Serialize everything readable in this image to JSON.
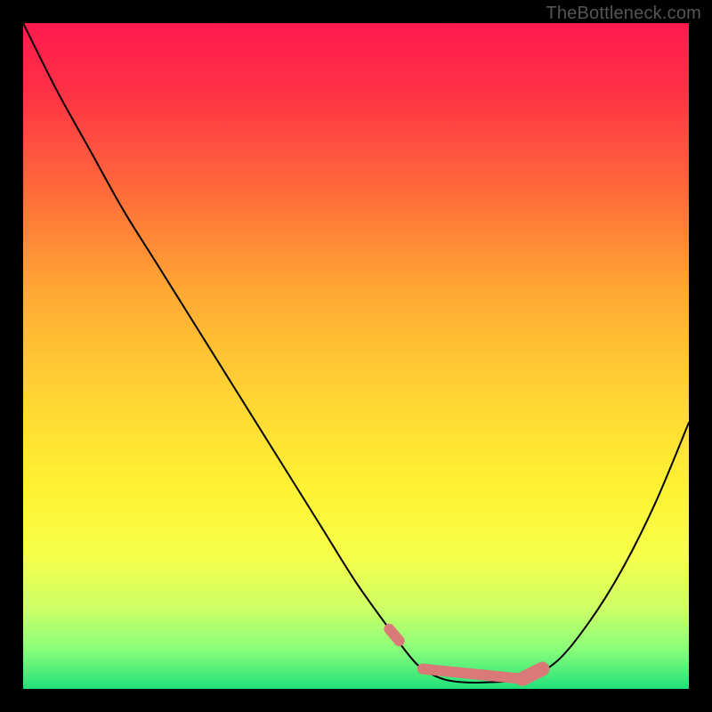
{
  "watermark": "TheBottleneck.com",
  "chart_data": {
    "type": "line",
    "title": "",
    "xlabel": "",
    "ylabel": "",
    "xlim": [
      0,
      100
    ],
    "ylim": [
      0,
      100
    ],
    "grid": false,
    "legend": false,
    "series": [
      {
        "name": "bottleneck_curve",
        "x": [
          0,
          5,
          10,
          15,
          20,
          25,
          30,
          35,
          40,
          45,
          50,
          55,
          58,
          60,
          63,
          66,
          70,
          75,
          80,
          85,
          90,
          95,
          100
        ],
        "values": [
          100,
          90,
          81,
          72,
          64,
          56,
          48,
          40,
          32,
          24,
          16,
          9,
          5,
          3,
          1.5,
          1.0,
          1.0,
          1.5,
          4,
          10,
          18,
          28,
          40
        ]
      }
    ],
    "highlight_segments": [
      {
        "x": [
          55,
          56.5
        ],
        "y": [
          9,
          7.2
        ],
        "width": 12
      },
      {
        "x": [
          60,
          75
        ],
        "y": [
          3,
          1.5
        ],
        "width": 12
      },
      {
        "x": [
          75,
          78
        ],
        "y": [
          1.5,
          3
        ],
        "width": 16
      }
    ],
    "highlight_color": "#d97a79",
    "background_gradient": [
      {
        "offset": 0.0,
        "color": "#ff1a4f"
      },
      {
        "offset": 0.1,
        "color": "#ff3046"
      },
      {
        "offset": 0.25,
        "color": "#ff6a3a"
      },
      {
        "offset": 0.4,
        "color": "#ffa733"
      },
      {
        "offset": 0.55,
        "color": "#ffd233"
      },
      {
        "offset": 0.7,
        "color": "#fff233"
      },
      {
        "offset": 0.8,
        "color": "#f6ff4a"
      },
      {
        "offset": 0.88,
        "color": "#ccff66"
      },
      {
        "offset": 0.94,
        "color": "#8aff7a"
      },
      {
        "offset": 1.0,
        "color": "#22e07a"
      }
    ]
  }
}
